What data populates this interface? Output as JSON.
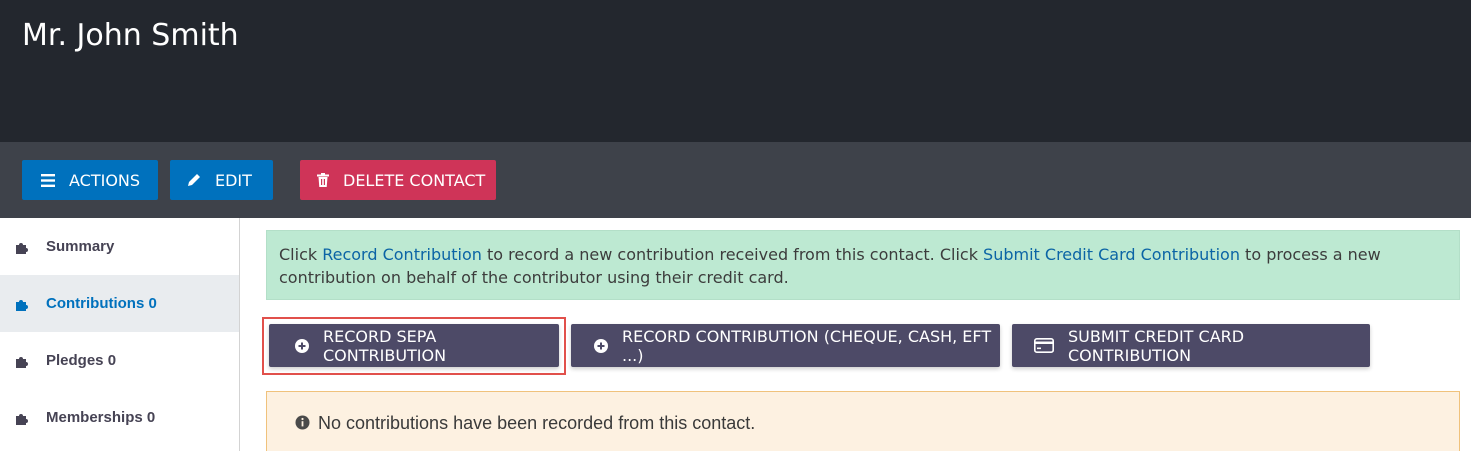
{
  "header": {
    "title": "Mr. John Smith"
  },
  "toolbar": {
    "actions_label": "ACTIONS",
    "edit_label": "EDIT",
    "delete_label": "DELETE CONTACT"
  },
  "sidebar": {
    "items": [
      {
        "label": "Summary",
        "active": false
      },
      {
        "label": "Contributions 0",
        "active": true
      },
      {
        "label": "Pledges 0",
        "active": false
      },
      {
        "label": "Memberships 0",
        "active": false
      }
    ]
  },
  "help": {
    "part1": "Click ",
    "link1": "Record Contribution",
    "part2": " to record a new contribution received from this contact. Click ",
    "link2": "Submit Credit Card Contribution",
    "part3": " to process a new contribution on behalf of the contributor using their credit card."
  },
  "buttons": {
    "sepa": "RECORD SEPA CONTRIBUTION",
    "record": "RECORD CONTRIBUTION (CHEQUE, CASH, EFT ...)",
    "credit": "SUBMIT CREDIT CARD CONTRIBUTION"
  },
  "notice": {
    "text": "No contributions have been recorded from this contact."
  },
  "colors": {
    "header_bg": "#23272e",
    "toolbar_bg": "#3e424a",
    "primary": "#0071bd",
    "danger": "#cf3458",
    "contrib_button": "#4d4a67",
    "help_bg": "#bde9d2",
    "notice_bg": "#fdf1e1",
    "highlight": "#e1504b"
  }
}
